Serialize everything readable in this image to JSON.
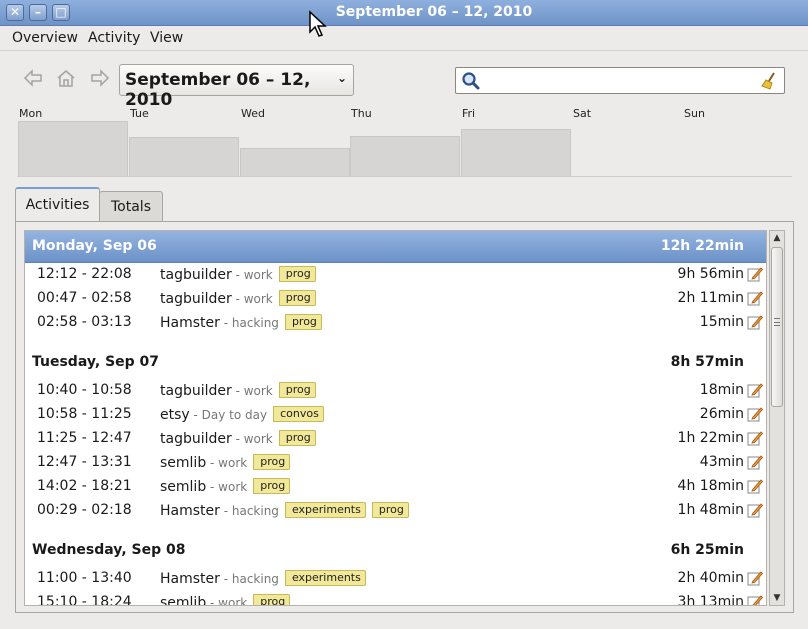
{
  "window": {
    "title": "September 06 – 12, 2010",
    "buttons": [
      {
        "name": "close",
        "icon": "close-icon",
        "glyph": "✕"
      },
      {
        "name": "minimize",
        "icon": "minimize-icon",
        "glyph": "–"
      },
      {
        "name": "maximize",
        "icon": "maximize-icon",
        "glyph": "□"
      }
    ]
  },
  "menu": [
    "Overview",
    "Activity",
    "View"
  ],
  "toolbar": {
    "prev_icon": "back-arrow-icon",
    "home_icon": "home-icon",
    "next_icon": "forward-arrow-icon",
    "date_range": "September 06 – 12, 2010",
    "search_value": "",
    "search_icon": "search-icon",
    "clear_icon": "broom-clear-icon"
  },
  "week_overview": {
    "days": [
      {
        "label": "Mon",
        "level": 0.74
      },
      {
        "label": "Tue",
        "level": 0.53
      },
      {
        "label": "Wed",
        "level": 0.38
      },
      {
        "label": "Thu",
        "level": 0.54
      },
      {
        "label": "Fri",
        "level": 0.63
      },
      {
        "label": "Sat",
        "level": 0
      },
      {
        "label": "Sun",
        "level": 0
      }
    ]
  },
  "tabs": [
    {
      "label": "Activities",
      "active": true
    },
    {
      "label": "Totals",
      "active": false
    }
  ],
  "colors": {
    "selection": "#7298cc",
    "tag_fill": "#f2e89a",
    "category_text": "#777777"
  },
  "groups": [
    {
      "title": "Monday, Sep 06",
      "total": "12h 22min",
      "selected": true,
      "entries": [
        {
          "time": "12:12 - 22:08",
          "name": "tagbuilder",
          "category": "work",
          "tags": [
            "prog"
          ],
          "duration": "9h 56min"
        },
        {
          "time": "00:47 - 02:58",
          "name": "tagbuilder",
          "category": "work",
          "tags": [
            "prog"
          ],
          "duration": "2h 11min"
        },
        {
          "time": "02:58 - 03:13",
          "name": "Hamster",
          "category": "hacking",
          "tags": [
            "prog"
          ],
          "duration": "15min"
        }
      ]
    },
    {
      "title": "Tuesday, Sep 07",
      "total": "8h 57min",
      "selected": false,
      "entries": [
        {
          "time": "10:40 - 10:58",
          "name": "tagbuilder",
          "category": "work",
          "tags": [
            "prog"
          ],
          "duration": "18min"
        },
        {
          "time": "10:58 - 11:25",
          "name": "etsy",
          "category": "Day to day",
          "tags": [
            "convos"
          ],
          "duration": "26min"
        },
        {
          "time": "11:25 - 12:47",
          "name": "tagbuilder",
          "category": "work",
          "tags": [
            "prog"
          ],
          "duration": "1h 22min"
        },
        {
          "time": "12:47 - 13:31",
          "name": "semlib",
          "category": "work",
          "tags": [
            "prog"
          ],
          "duration": "43min"
        },
        {
          "time": "14:02 - 18:21",
          "name": "semlib",
          "category": "work",
          "tags": [
            "prog"
          ],
          "duration": "4h 18min"
        },
        {
          "time": "00:29 - 02:18",
          "name": "Hamster",
          "category": "hacking",
          "tags": [
            "experiments",
            "prog"
          ],
          "duration": "1h 48min"
        }
      ]
    },
    {
      "title": "Wednesday, Sep 08",
      "total": "6h 25min",
      "selected": false,
      "entries": [
        {
          "time": "11:00 - 13:40",
          "name": "Hamster",
          "category": "hacking",
          "tags": [
            "experiments"
          ],
          "duration": "2h 40min"
        },
        {
          "time": "15:10 - 18:24",
          "name": "semlib",
          "category": "work",
          "tags": [
            "prog"
          ],
          "duration": "3h 13min"
        }
      ]
    }
  ]
}
